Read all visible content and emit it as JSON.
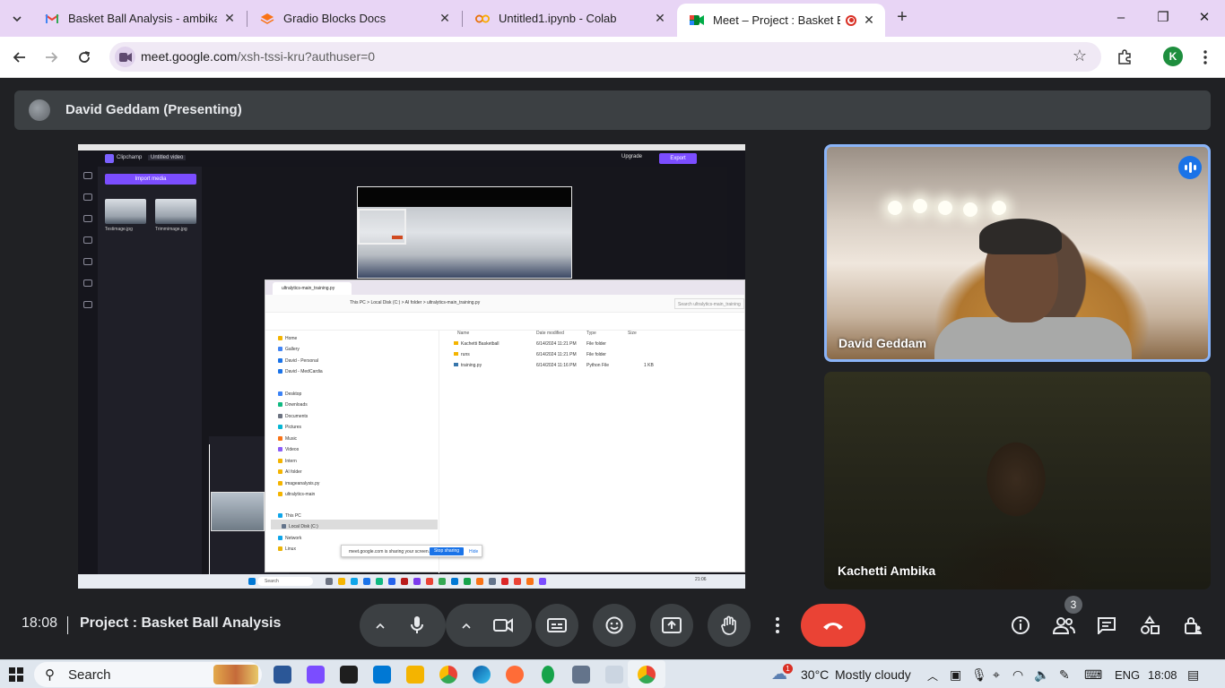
{
  "browser": {
    "tabs": [
      {
        "title": "Basket Ball Analysis - ambika93",
        "icon": "gmail-icon",
        "active": false
      },
      {
        "title": "Gradio Blocks Docs",
        "icon": "gradio-icon",
        "active": false
      },
      {
        "title": "Untitled1.ipynb - Colab",
        "icon": "colab-icon",
        "active": false
      },
      {
        "title": "Meet – Project : Basket Ball",
        "icon": "meet-icon",
        "active": true
      }
    ],
    "url_host": "meet.google.com",
    "url_path": "/xsh-tssi-kru?authuser=0",
    "profile_initial": "K"
  },
  "meet": {
    "presenter_banner": "David Geddam (Presenting)",
    "time": "18:08",
    "meeting_title": "Project : Basket Ball Analysis",
    "participants": [
      {
        "name": "David Geddam",
        "speaking": true
      },
      {
        "name": "Kachetti Ambika",
        "speaking": false
      }
    ],
    "participant_count": "3",
    "colors": {
      "end_call": "#ea4335",
      "active_border": "#8ab4f8",
      "speaking": "#1a73e8"
    }
  },
  "shared_screen": {
    "clipchamp": {
      "app_name": "Clipchamp",
      "project_name": "Untitled video",
      "upgrade_label": "Upgrade",
      "export_label": "Export",
      "import_label": "Import media",
      "media": [
        "Testimage.jpg",
        "Trimmimage.jpg"
      ]
    },
    "explorer": {
      "tab_title": "ultralytics-main_training.py",
      "path": "This PC  >  Local Disk (C:)  >  AI folder  >  ultralytics-main_training.py",
      "search_placeholder": "Search ultralytics-main_training",
      "columns": [
        "Name",
        "Date modified",
        "Type",
        "Size"
      ],
      "rows": [
        {
          "name": "Kachetti Basketball",
          "date": "6/14/2024 11:21 PM",
          "type": "File folder",
          "size": ""
        },
        {
          "name": "runs",
          "date": "6/14/2024 11:21 PM",
          "type": "File folder",
          "size": ""
        },
        {
          "name": "training.py",
          "date": "6/14/2024 11:16 PM",
          "type": "Python File",
          "size": "1 KB"
        }
      ],
      "nav": [
        "Home",
        "Gallery",
        "David - Personal",
        "David - MedCardia",
        "Desktop",
        "Downloads",
        "Documents",
        "Pictures",
        "Music",
        "Videos",
        "Intern",
        "AI folder",
        "imageanalysis.py",
        "ultralytics-main",
        "This PC",
        "Local Disk (C:)",
        "Network",
        "Linux"
      ],
      "share_msg": "meet.google.com is sharing your screen.",
      "stop_label": "Stop sharing",
      "hide_label": "Hide"
    },
    "mini_taskbar": {
      "search": "Search",
      "clock": "21:06"
    }
  },
  "taskbar": {
    "search_label": "Search",
    "weather_temp": "30°C",
    "weather_desc": "Mostly cloudy",
    "weather_badge": "1",
    "lang": "ENG",
    "time": "18:08"
  }
}
